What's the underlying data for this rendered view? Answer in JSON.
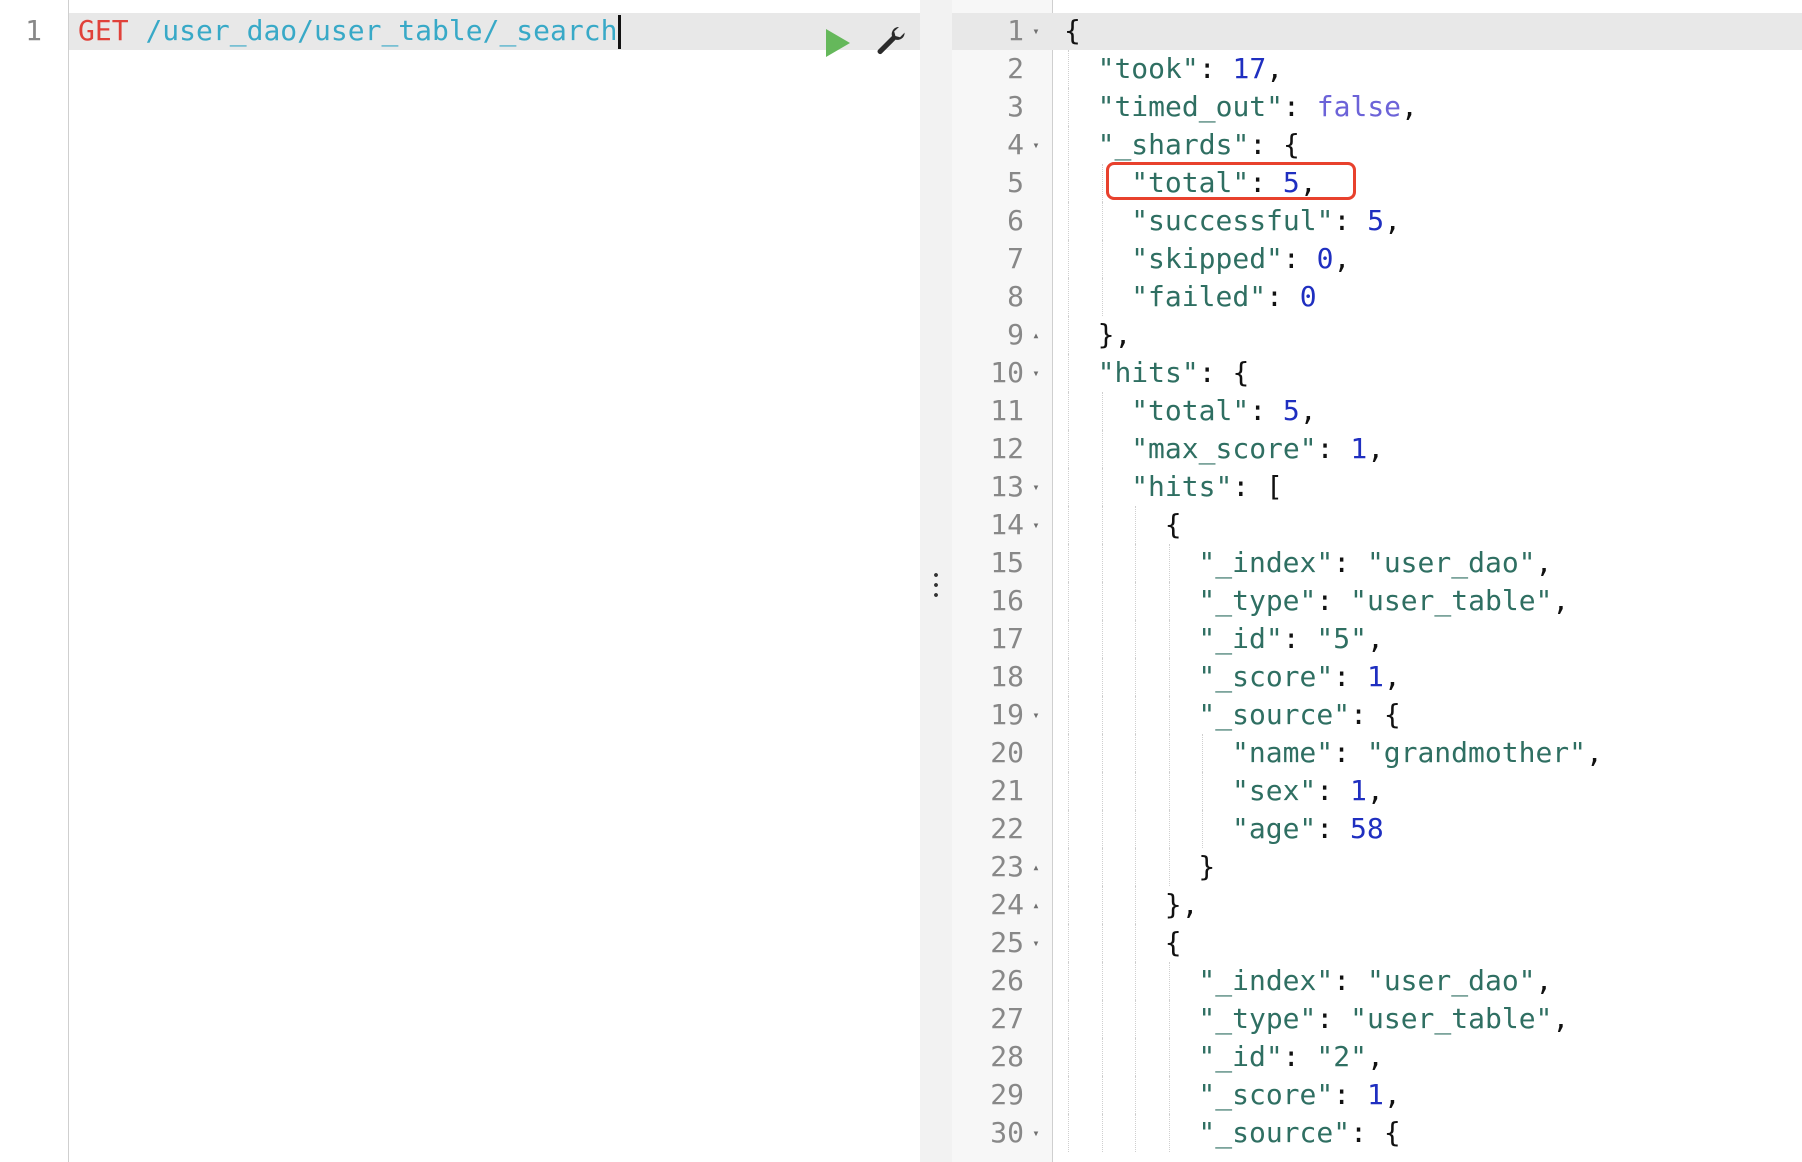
{
  "request": {
    "lines": [
      {
        "number": "1",
        "method": "GET",
        "url": "/user_dao/user_table/_search"
      }
    ]
  },
  "response": {
    "lines": [
      {
        "number": "1",
        "fold": "down",
        "indent": 0,
        "tokens": [
          {
            "t": "punc",
            "v": "{"
          }
        ]
      },
      {
        "number": "2",
        "indent": 1,
        "tokens": [
          {
            "t": "key",
            "v": "\"took\""
          },
          {
            "t": "punc",
            "v": ": "
          },
          {
            "t": "number",
            "v": "17"
          },
          {
            "t": "punc",
            "v": ","
          }
        ]
      },
      {
        "number": "3",
        "indent": 1,
        "tokens": [
          {
            "t": "key",
            "v": "\"timed_out\""
          },
          {
            "t": "punc",
            "v": ": "
          },
          {
            "t": "bool",
            "v": "false"
          },
          {
            "t": "punc",
            "v": ","
          }
        ]
      },
      {
        "number": "4",
        "fold": "down",
        "indent": 1,
        "tokens": [
          {
            "t": "key",
            "v": "\"_shards\""
          },
          {
            "t": "punc",
            "v": ": {"
          }
        ]
      },
      {
        "number": "5",
        "indent": 2,
        "tokens": [
          {
            "t": "key",
            "v": "\"total\""
          },
          {
            "t": "punc",
            "v": ": "
          },
          {
            "t": "number",
            "v": "5"
          },
          {
            "t": "punc",
            "v": ","
          }
        ]
      },
      {
        "number": "6",
        "indent": 2,
        "tokens": [
          {
            "t": "key",
            "v": "\"successful\""
          },
          {
            "t": "punc",
            "v": ": "
          },
          {
            "t": "number",
            "v": "5"
          },
          {
            "t": "punc",
            "v": ","
          }
        ]
      },
      {
        "number": "7",
        "indent": 2,
        "tokens": [
          {
            "t": "key",
            "v": "\"skipped\""
          },
          {
            "t": "punc",
            "v": ": "
          },
          {
            "t": "number",
            "v": "0"
          },
          {
            "t": "punc",
            "v": ","
          }
        ]
      },
      {
        "number": "8",
        "indent": 2,
        "tokens": [
          {
            "t": "key",
            "v": "\"failed\""
          },
          {
            "t": "punc",
            "v": ": "
          },
          {
            "t": "number",
            "v": "0"
          }
        ]
      },
      {
        "number": "9",
        "fold": "up",
        "indent": 1,
        "tokens": [
          {
            "t": "punc",
            "v": "},"
          }
        ]
      },
      {
        "number": "10",
        "fold": "down",
        "indent": 1,
        "tokens": [
          {
            "t": "key",
            "v": "\"hits\""
          },
          {
            "t": "punc",
            "v": ": {"
          }
        ]
      },
      {
        "number": "11",
        "indent": 2,
        "tokens": [
          {
            "t": "key",
            "v": "\"total\""
          },
          {
            "t": "punc",
            "v": ": "
          },
          {
            "t": "number",
            "v": "5"
          },
          {
            "t": "punc",
            "v": ","
          }
        ]
      },
      {
        "number": "12",
        "indent": 2,
        "tokens": [
          {
            "t": "key",
            "v": "\"max_score\""
          },
          {
            "t": "punc",
            "v": ": "
          },
          {
            "t": "number",
            "v": "1"
          },
          {
            "t": "punc",
            "v": ","
          }
        ]
      },
      {
        "number": "13",
        "fold": "down",
        "indent": 2,
        "tokens": [
          {
            "t": "key",
            "v": "\"hits\""
          },
          {
            "t": "punc",
            "v": ": ["
          }
        ]
      },
      {
        "number": "14",
        "fold": "down",
        "indent": 3,
        "tokens": [
          {
            "t": "punc",
            "v": "{"
          }
        ]
      },
      {
        "number": "15",
        "indent": 4,
        "tokens": [
          {
            "t": "key",
            "v": "\"_index\""
          },
          {
            "t": "punc",
            "v": ": "
          },
          {
            "t": "string",
            "v": "\"user_dao\""
          },
          {
            "t": "punc",
            "v": ","
          }
        ]
      },
      {
        "number": "16",
        "indent": 4,
        "tokens": [
          {
            "t": "key",
            "v": "\"_type\""
          },
          {
            "t": "punc",
            "v": ": "
          },
          {
            "t": "string",
            "v": "\"user_table\""
          },
          {
            "t": "punc",
            "v": ","
          }
        ]
      },
      {
        "number": "17",
        "indent": 4,
        "tokens": [
          {
            "t": "key",
            "v": "\"_id\""
          },
          {
            "t": "punc",
            "v": ": "
          },
          {
            "t": "string",
            "v": "\"5\""
          },
          {
            "t": "punc",
            "v": ","
          }
        ]
      },
      {
        "number": "18",
        "indent": 4,
        "tokens": [
          {
            "t": "key",
            "v": "\"_score\""
          },
          {
            "t": "punc",
            "v": ": "
          },
          {
            "t": "number",
            "v": "1"
          },
          {
            "t": "punc",
            "v": ","
          }
        ]
      },
      {
        "number": "19",
        "fold": "down",
        "indent": 4,
        "tokens": [
          {
            "t": "key",
            "v": "\"_source\""
          },
          {
            "t": "punc",
            "v": ": {"
          }
        ]
      },
      {
        "number": "20",
        "indent": 5,
        "tokens": [
          {
            "t": "key",
            "v": "\"name\""
          },
          {
            "t": "punc",
            "v": ": "
          },
          {
            "t": "string",
            "v": "\"grandmother\""
          },
          {
            "t": "punc",
            "v": ","
          }
        ]
      },
      {
        "number": "21",
        "indent": 5,
        "tokens": [
          {
            "t": "key",
            "v": "\"sex\""
          },
          {
            "t": "punc",
            "v": ": "
          },
          {
            "t": "number",
            "v": "1"
          },
          {
            "t": "punc",
            "v": ","
          }
        ]
      },
      {
        "number": "22",
        "indent": 5,
        "tokens": [
          {
            "t": "key",
            "v": "\"age\""
          },
          {
            "t": "punc",
            "v": ": "
          },
          {
            "t": "number",
            "v": "58"
          }
        ]
      },
      {
        "number": "23",
        "fold": "up",
        "indent": 4,
        "tokens": [
          {
            "t": "punc",
            "v": "}"
          }
        ]
      },
      {
        "number": "24",
        "fold": "up",
        "indent": 3,
        "tokens": [
          {
            "t": "punc",
            "v": "},"
          }
        ]
      },
      {
        "number": "25",
        "fold": "down",
        "indent": 3,
        "tokens": [
          {
            "t": "punc",
            "v": "{"
          }
        ]
      },
      {
        "number": "26",
        "indent": 4,
        "tokens": [
          {
            "t": "key",
            "v": "\"_index\""
          },
          {
            "t": "punc",
            "v": ": "
          },
          {
            "t": "string",
            "v": "\"user_dao\""
          },
          {
            "t": "punc",
            "v": ","
          }
        ]
      },
      {
        "number": "27",
        "indent": 4,
        "tokens": [
          {
            "t": "key",
            "v": "\"_type\""
          },
          {
            "t": "punc",
            "v": ": "
          },
          {
            "t": "string",
            "v": "\"user_table\""
          },
          {
            "t": "punc",
            "v": ","
          }
        ]
      },
      {
        "number": "28",
        "indent": 4,
        "tokens": [
          {
            "t": "key",
            "v": "\"_id\""
          },
          {
            "t": "punc",
            "v": ": "
          },
          {
            "t": "string",
            "v": "\"2\""
          },
          {
            "t": "punc",
            "v": ","
          }
        ]
      },
      {
        "number": "29",
        "indent": 4,
        "tokens": [
          {
            "t": "key",
            "v": "\"_score\""
          },
          {
            "t": "punc",
            "v": ": "
          },
          {
            "t": "number",
            "v": "1"
          },
          {
            "t": "punc",
            "v": ","
          }
        ]
      },
      {
        "number": "30",
        "fold": "down",
        "indent": 4,
        "tokens": [
          {
            "t": "key",
            "v": "\"_source\""
          },
          {
            "t": "punc",
            "v": ": {"
          }
        ]
      }
    ]
  },
  "icons": {
    "run": "play-icon",
    "settings": "wrench-icon",
    "fold_open": "fold-down-icon",
    "fold_close": "fold-up-icon",
    "divider": "vertical-dots-icon"
  },
  "colors": {
    "method": "#e0413a",
    "url": "#38a9c7",
    "key": "#2f6f62",
    "number": "#1f2fc0",
    "bool": "#6c63d8",
    "highlight_border": "#e8412d",
    "run_button": "#65b85b"
  }
}
